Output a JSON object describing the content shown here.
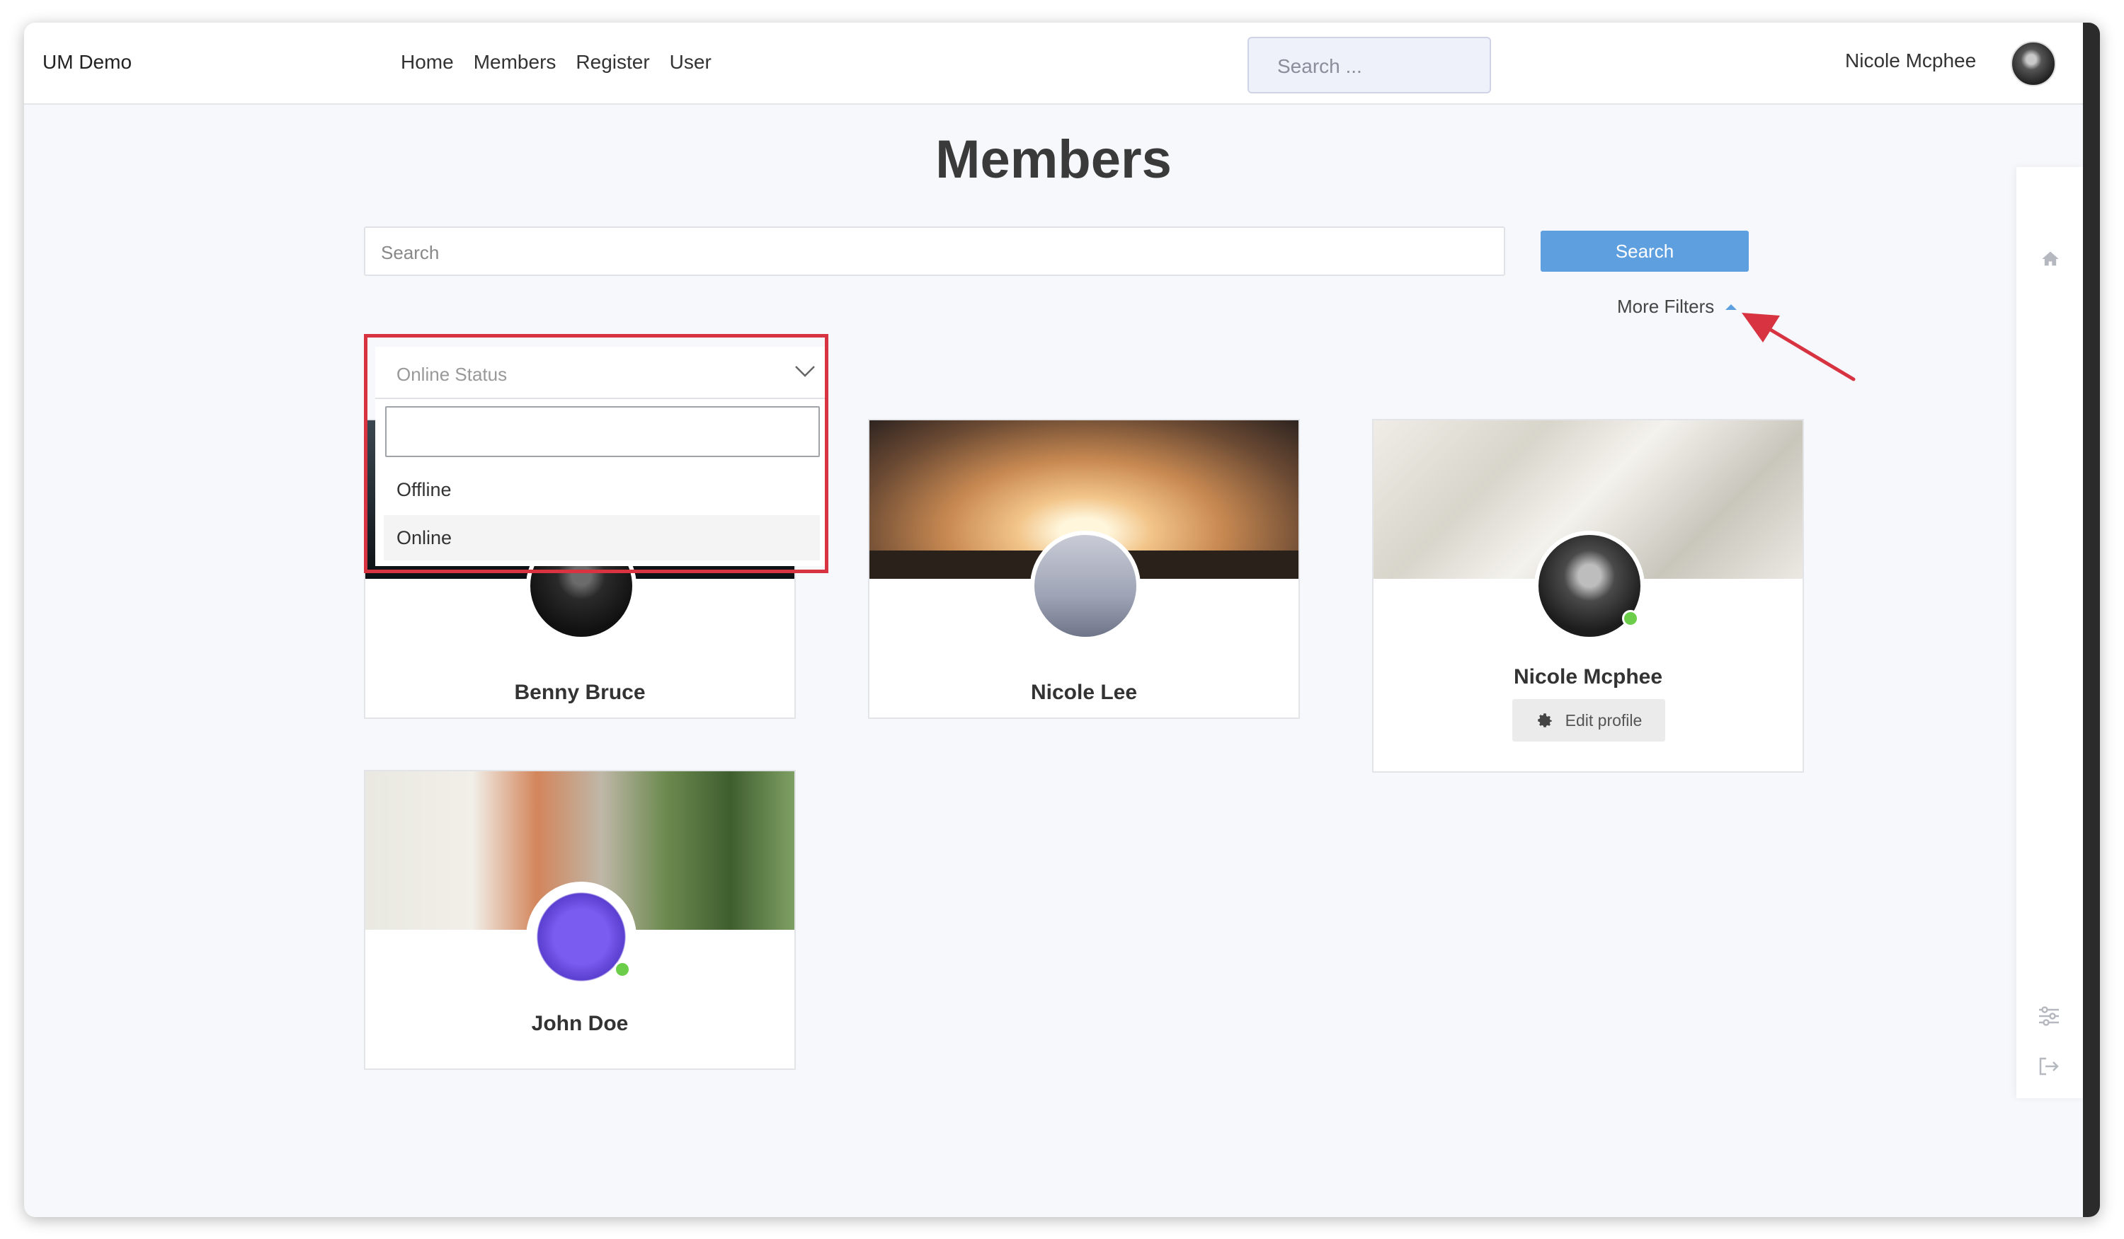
{
  "topbar": {
    "brand": "UM Demo",
    "nav": [
      "Home",
      "Members",
      "Register",
      "User"
    ],
    "search_placeholder": "Search ...",
    "user_name": "Nicole Mcphee"
  },
  "page": {
    "title": "Members",
    "search_placeholder": "Search",
    "search_button": "Search",
    "more_filters": "More Filters"
  },
  "filter": {
    "placeholder": "Online Status",
    "options": [
      "Offline",
      "Online"
    ],
    "selected": "Online"
  },
  "members": [
    {
      "name": "Benny Bruce",
      "online": false
    },
    {
      "name": "Nicole Lee",
      "online": false
    },
    {
      "name": "Nicole Mcphee",
      "online": true,
      "edit_label": "Edit profile"
    },
    {
      "name": "John Doe",
      "online": true
    }
  ],
  "colors": {
    "accent": "#5e9fe0",
    "highlight": "#d73341",
    "online": "#6ccd4b"
  }
}
